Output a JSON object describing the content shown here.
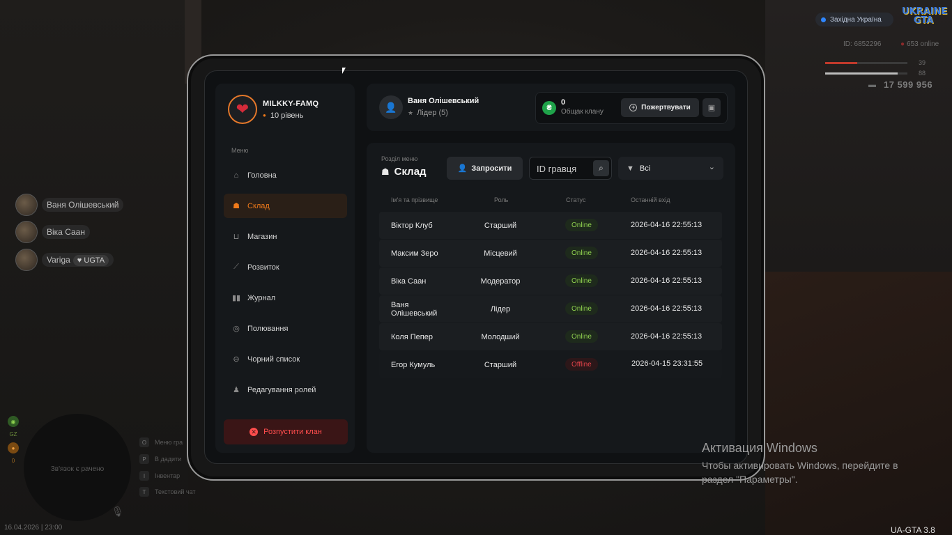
{
  "hud": {
    "region": "Західна Україна",
    "logo": "UKRAINE GTA",
    "player_id": "ID: 6852296",
    "online": "653 online",
    "health": "39",
    "health_level": 0.39,
    "armor": "88",
    "armor_level": 0.88,
    "money": "17 599 956",
    "health_color": "#c0392b",
    "armor_color": "#bdbdbd"
  },
  "players": [
    {
      "name": "Ваня Олішевський"
    },
    {
      "name": "Віка Саан"
    },
    {
      "name": "Variga",
      "badge": "UGTA"
    }
  ],
  "minimap": {
    "text": "Зв'язок є рачено",
    "levels": [
      "GZ",
      "0"
    ],
    "hints": [
      {
        "key": "O",
        "label": "Меню гра"
      },
      {
        "key": "P",
        "label": "В дадити"
      },
      {
        "key": "I",
        "label": "Інвентар"
      },
      {
        "key": "T",
        "label": "Текстовий чат"
      }
    ],
    "datetime": "16.04.2026 | 23:00"
  },
  "tablet": {
    "clan": {
      "name": "MILKKY-FAMQ",
      "level": "10 рівень"
    },
    "menu_title": "Меню",
    "menu": [
      {
        "label": "Головна",
        "icon": "home-icon"
      },
      {
        "label": "Склад",
        "icon": "users-icon",
        "active": true
      },
      {
        "label": "Магазин",
        "icon": "basket-icon"
      },
      {
        "label": "Розвиток",
        "icon": "chart-icon"
      },
      {
        "label": "Журнал",
        "icon": "book-icon"
      },
      {
        "label": "Полювання",
        "icon": "target-icon"
      },
      {
        "label": "Чорний список",
        "icon": "block-icon"
      },
      {
        "label": "Редагування ролей",
        "icon": "user-edit-icon"
      }
    ],
    "disband_label": "Розпустити клан",
    "user": {
      "name": "Ваня Олішевський",
      "role": "Лідер (5)"
    },
    "bank": {
      "amount": "0",
      "label": "Общак клану",
      "currency_symbol": "₴"
    },
    "donate_label": "Пожертвувати",
    "section_label": "Розділ меню",
    "section_title": "Склад",
    "invite_label": "Запросити",
    "search_placeholder": "ID гравця",
    "filter_value": "Всі",
    "columns": [
      "Ім'я та прізвище",
      "Роль",
      "Статус",
      "Останній вхід"
    ],
    "members": [
      {
        "name": "Віктор Клуб",
        "role": "Старший",
        "status": "Online",
        "last": "2026-04-16 22:55:13"
      },
      {
        "name": "Максим Зеро",
        "role": "Місцевий",
        "status": "Online",
        "last": "2026-04-16 22:55:13"
      },
      {
        "name": "Віка Саан",
        "role": "Модератор",
        "status": "Online",
        "last": "2026-04-16 22:55:13"
      },
      {
        "name": "Ваня Олішевський",
        "role": "Лідер",
        "status": "Online",
        "last": "2026-04-16 22:55:13"
      },
      {
        "name": "Коля Пепер",
        "role": "Молодший",
        "status": "Online",
        "last": "2026-04-16 22:55:13"
      },
      {
        "name": "Егор Кумуль",
        "role": "Старший",
        "status": "Offline",
        "last": "2026-04-15 23:31:55"
      }
    ],
    "accent_color": "#f07a1a",
    "online_color": "#8fd14f",
    "offline_color": "#e4434a"
  },
  "windows": {
    "title": "Активация Windows",
    "line1": "Чтобы активировать Windows, перейдите в",
    "line2": "раздел \"Параметры\"."
  },
  "version": "UA-GTA 3.8"
}
